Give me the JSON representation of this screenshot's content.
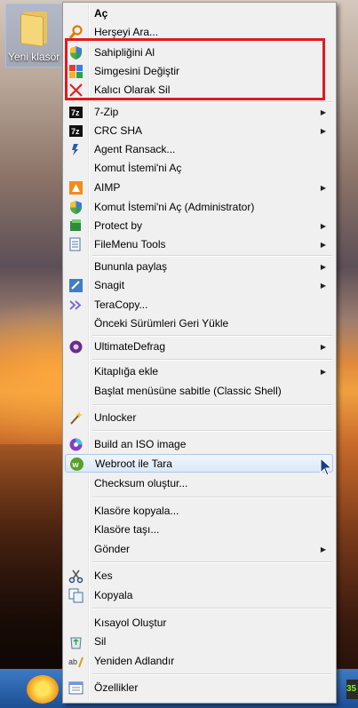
{
  "desktop": {
    "folder_label": "Yeni klasör"
  },
  "menu": {
    "items": [
      {
        "label": "Aç",
        "icon": "none",
        "bold": true
      },
      {
        "label": "Herşeyi Ara...",
        "icon": "search-magnifier-icon"
      },
      {
        "label": "Sahipliğini Al",
        "icon": "shield-icon"
      },
      {
        "label": "Simgesini Değiştir",
        "icon": "change-icon-icon"
      },
      {
        "label": "Kalıcı Olarak Sil",
        "icon": "delete-x-icon"
      },
      {
        "label": "7-Zip",
        "icon": "7zip-icon",
        "submenu": true
      },
      {
        "label": "CRC SHA",
        "icon": "7zip-icon",
        "submenu": true
      },
      {
        "label": "Agent Ransack...",
        "icon": "agent-ransack-icon"
      },
      {
        "label": "Komut İstemi'ni Aç",
        "icon": "none"
      },
      {
        "label": "AIMP",
        "icon": "aimp-icon",
        "submenu": true
      },
      {
        "label": "Komut İstemi'ni Aç (Administrator)",
        "icon": "shield-icon"
      },
      {
        "label": "Protect by",
        "icon": "protect-icon",
        "submenu": true
      },
      {
        "label": "FileMenu Tools",
        "icon": "filemenu-icon",
        "submenu": true
      },
      {
        "label": "Bununla paylaş",
        "icon": "none",
        "submenu": true
      },
      {
        "label": "Snagit",
        "icon": "snagit-icon",
        "submenu": true
      },
      {
        "label": "TeraCopy...",
        "icon": "teracopy-icon"
      },
      {
        "label": "Önceki Sürümleri Geri Yükle",
        "icon": "none"
      },
      {
        "label": "UltimateDefrag",
        "icon": "defrag-icon",
        "submenu": true
      },
      {
        "label": "Kitaplığa ekle",
        "icon": "none",
        "submenu": true
      },
      {
        "label": "Başlat menüsüne sabitle (Classic Shell)",
        "icon": "none"
      },
      {
        "label": "Unlocker",
        "icon": "unlocker-wand-icon"
      },
      {
        "label": "Build an ISO image",
        "icon": "iso-icon"
      },
      {
        "label": "Webroot ile Tara",
        "icon": "webroot-icon"
      },
      {
        "label": "Checksum oluştur...",
        "icon": "none"
      },
      {
        "label": "Klasöre kopyala...",
        "icon": "none"
      },
      {
        "label": "Klasöre taşı...",
        "icon": "none"
      },
      {
        "label": "Gönder",
        "icon": "none",
        "submenu": true
      },
      {
        "label": "Kes",
        "icon": "scissors-icon"
      },
      {
        "label": "Kopyala",
        "icon": "copy-icon"
      },
      {
        "label": "Kısayol Oluştur",
        "icon": "none"
      },
      {
        "label": "Sil",
        "icon": "recycle-icon"
      },
      {
        "label": "Yeniden Adlandır",
        "icon": "rename-icon"
      },
      {
        "label": "Özellikler",
        "icon": "properties-icon"
      }
    ]
  },
  "tray": {
    "badge_text": "35"
  },
  "colors": {
    "highlight_box": "#e01b1b",
    "menu_bg": "#f0f0f0",
    "hover_bg": "#dbe8f7"
  }
}
